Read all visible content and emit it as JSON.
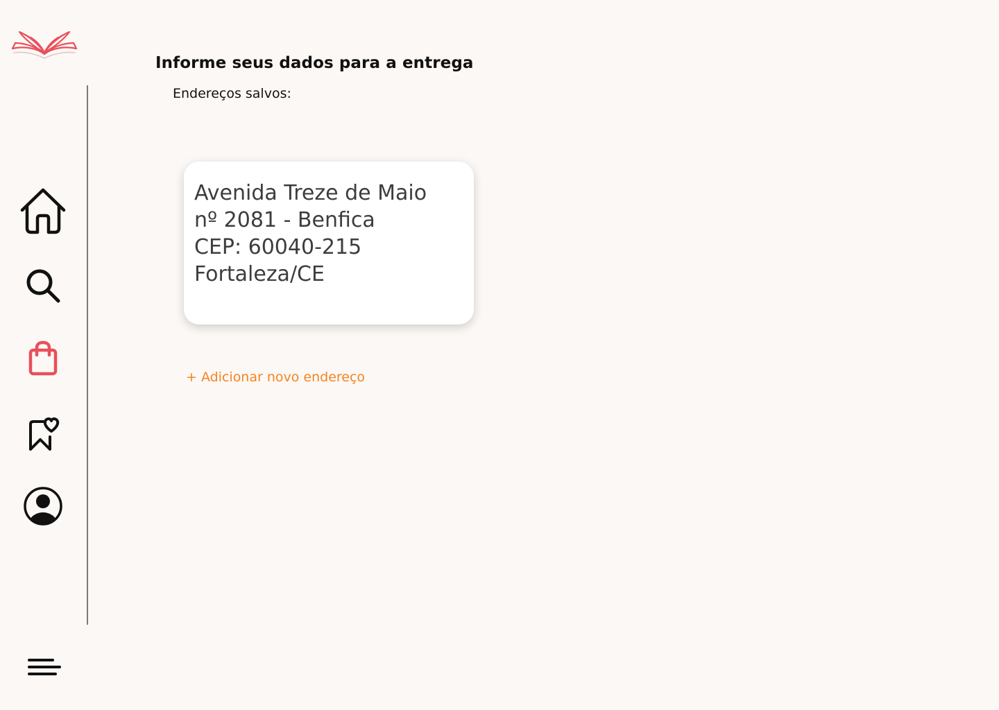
{
  "app": {
    "logo_icon": "open-book-icon",
    "accent_color": "#e8505b",
    "link_color": "#f5841f"
  },
  "sidebar": {
    "items": [
      {
        "icon": "home-icon",
        "active": false
      },
      {
        "icon": "search-icon",
        "active": false
      },
      {
        "icon": "shopping-bag-icon",
        "active": true
      },
      {
        "icon": "bookmark-heart-icon",
        "active": false
      },
      {
        "icon": "user-circle-icon",
        "active": false
      }
    ],
    "menu_icon": "menu-icon"
  },
  "main": {
    "title": "Informe seus dados para a entrega",
    "saved_label": "Endereços salvos:",
    "address_card": {
      "line1": "Avenida Treze de Maio",
      "line2": "nº 2081 - Benfica",
      "line3": "CEP: 60040-215",
      "line4": "Fortaleza/CE"
    },
    "add_address_label": "+ Adicionar novo endereço"
  }
}
